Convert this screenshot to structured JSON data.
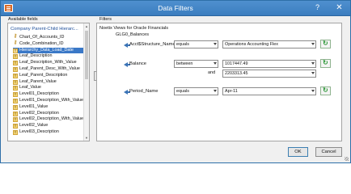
{
  "window": {
    "title": "Data Filters",
    "help_symbol": "?",
    "close_symbol": "✕"
  },
  "labels": {
    "available_fields": "Available fields",
    "filters": "Filters"
  },
  "fields_panel": {
    "root": "Company Parent-Child Hierarc...",
    "items": [
      {
        "label": "Chart_Of_Accounts_ID",
        "icon": "key-icon"
      },
      {
        "label": "Code_Combination_ID",
        "icon": "key-icon"
      },
      {
        "label": "Hierarchy_Data_Load_Date",
        "icon": "field-icon",
        "selected": true
      },
      {
        "label": "Leaf_Description",
        "icon": "text-field-icon"
      },
      {
        "label": "Leaf_Description_With_Value",
        "icon": "text-field-icon"
      },
      {
        "label": "Leaf_Parent_Desc_With_Value",
        "icon": "text-field-icon"
      },
      {
        "label": "Leaf_Parent_Description",
        "icon": "text-field-icon"
      },
      {
        "label": "Leaf_Parent_Value",
        "icon": "text-field-icon"
      },
      {
        "label": "Leaf_Value",
        "icon": "text-field-icon"
      },
      {
        "label": "Level01_Description",
        "icon": "text-field-icon"
      },
      {
        "label": "Level01_Description_With_Value",
        "icon": "text-field-icon"
      },
      {
        "label": "Level01_Value",
        "icon": "text-field-icon"
      },
      {
        "label": "Level02_Description",
        "icon": "text-field-icon"
      },
      {
        "label": "Level02_Description_With_Value",
        "icon": "text-field-icon"
      },
      {
        "label": "Level02_Value",
        "icon": "text-field-icon"
      },
      {
        "label": "Level03_Description",
        "icon": "text-field-icon"
      }
    ]
  },
  "filters_panel": {
    "view_title": "Noetix Views for Oracle Financials",
    "group_title": "GLG0_Balances",
    "rows": [
      {
        "field": "Acct$Structure_Name",
        "operator": "equals",
        "value": "Operations Accounting Flex"
      },
      {
        "field": "Balance",
        "operator": "between",
        "value": "1017447.49",
        "and_label": "and",
        "value2": "2203313.45"
      },
      {
        "field": "Period_Name",
        "operator": "equals",
        "value": "Apr-11"
      }
    ]
  },
  "buttons": {
    "ok": "OK",
    "cancel": "Cancel"
  },
  "icons": {
    "app": "app-filter-icon",
    "move": "move-right-arrow-icon",
    "refresh": "refresh-icon"
  },
  "colors": {
    "titlebar": "#3b7dbf",
    "selection": "#3a78c7",
    "arrow": "#3a73b6",
    "refresh": "#2f9a3a"
  }
}
